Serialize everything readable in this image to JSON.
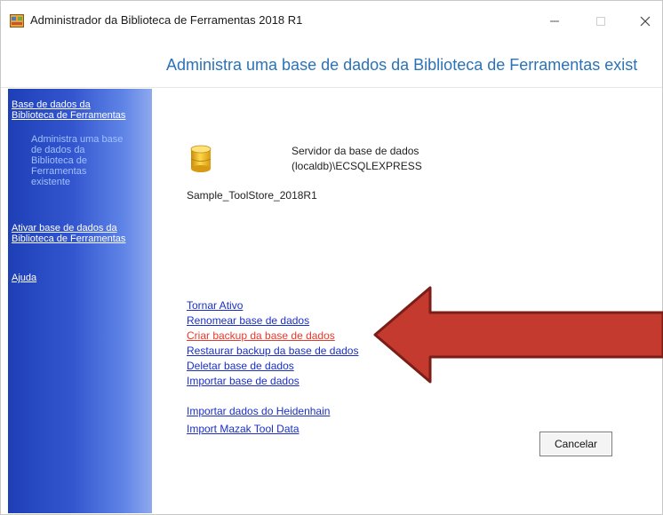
{
  "window": {
    "title": "Administrador da Biblioteca de Ferramentas 2018 R1",
    "icon": "toolbox-app-icon"
  },
  "header": {
    "title": "Administra uma base de dados da Biblioteca de Ferramentas exist"
  },
  "sidebar": {
    "items": [
      {
        "label": "Base de dados da Biblioteca de Ferramentas"
      },
      {
        "label": "Administra uma base de dados da Biblioteca de Ferramentas existente"
      },
      {
        "label": "Ativar base de dados da Biblioteca de Ferramentas"
      },
      {
        "label": "Ajuda"
      }
    ]
  },
  "database": {
    "server_label": "Servidor da base de dados",
    "server_value": "(localdb)\\ECSQLEXPRESS",
    "name": "Sample_ToolStore_2018R1"
  },
  "actions": [
    {
      "label": "Tornar Ativo"
    },
    {
      "label": "Renomear base de dados"
    },
    {
      "label": "Criar backup da base de dados"
    },
    {
      "label": "Restaurar backup da base de dados"
    },
    {
      "label": "Deletar base de dados"
    },
    {
      "label": "Importar base de dados"
    },
    {
      "label": "Importar dados do Heidenhain"
    },
    {
      "label": "Import Mazak Tool Data"
    }
  ],
  "buttons": {
    "cancel": "Cancelar"
  },
  "colors": {
    "accent": "#2a73b8",
    "link": "#1a2fc8",
    "highlight_link": "#e8392c",
    "arrow": "#c0392b",
    "sidebar": "#1e3fb6"
  }
}
